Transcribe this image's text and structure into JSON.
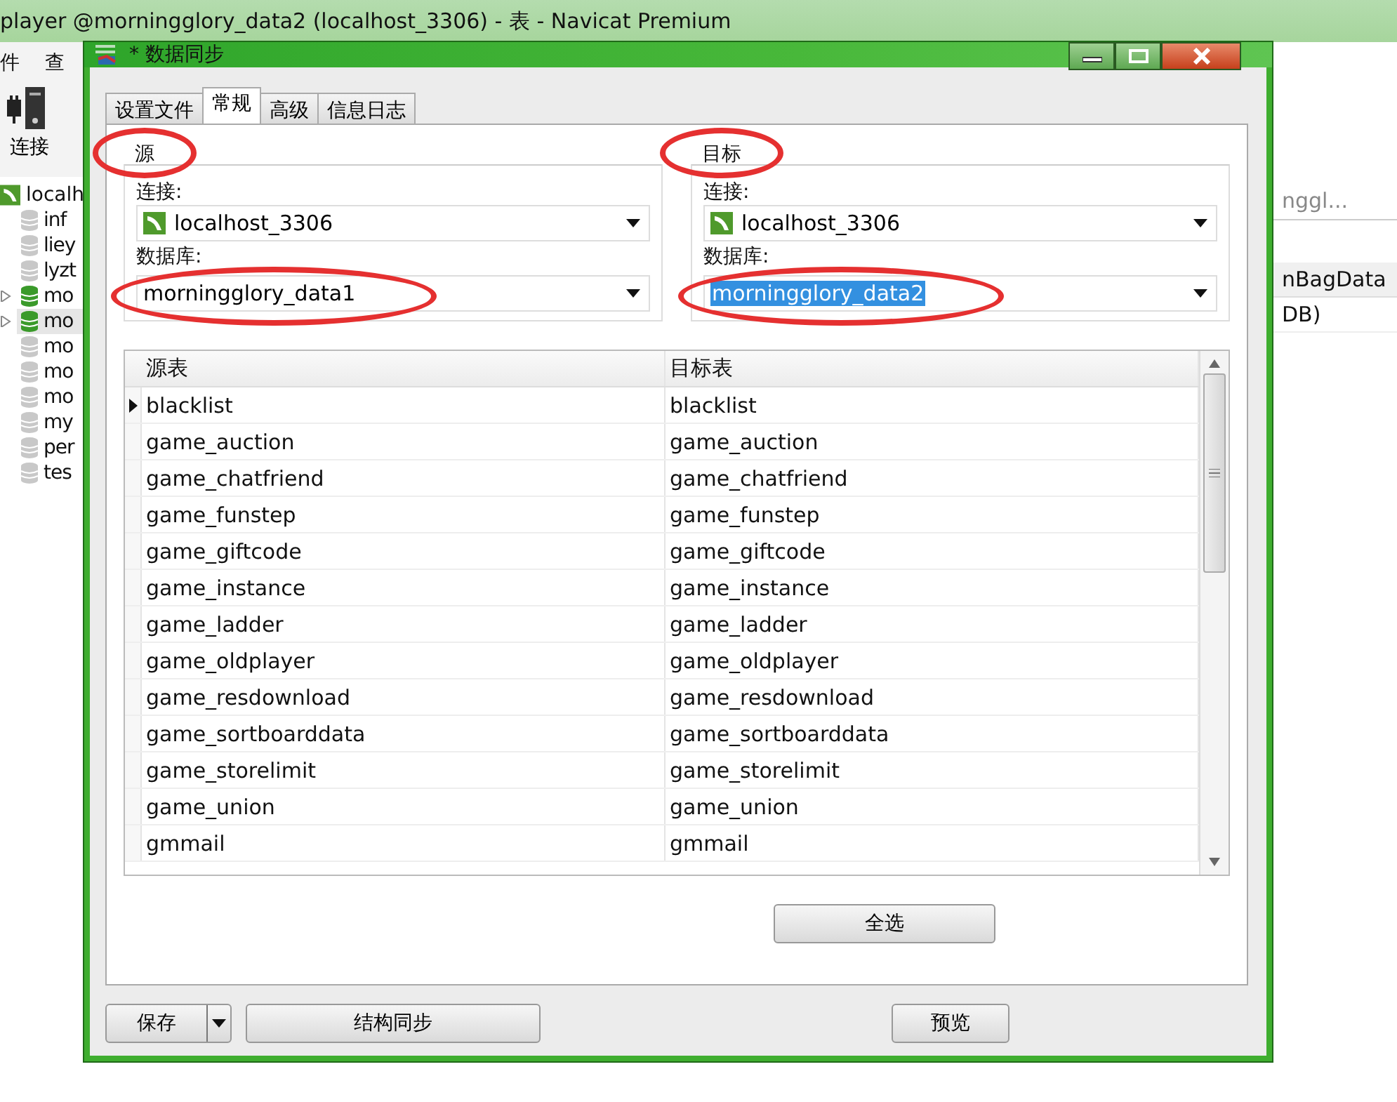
{
  "main_window": {
    "title": "player @morningglory_data2 (localhost_3306) - 表 - Navicat Premium",
    "menu": [
      "件",
      "查"
    ],
    "toolbar": [
      {
        "label": "连接"
      }
    ],
    "tree": [
      {
        "label": "localh",
        "children": [
          {
            "label": "inf",
            "open": false,
            "selected": false
          },
          {
            "label": "liey",
            "open": false,
            "selected": false
          },
          {
            "label": "lyzt",
            "open": false,
            "selected": false
          },
          {
            "label": "mo",
            "open": true,
            "selected": false
          },
          {
            "label": "mo",
            "open": true,
            "selected": true
          },
          {
            "label": "mo",
            "open": false,
            "selected": false
          },
          {
            "label": "mo",
            "open": false,
            "selected": false
          },
          {
            "label": "mo",
            "open": false,
            "selected": false
          },
          {
            "label": "my",
            "open": false,
            "selected": false
          },
          {
            "label": "per",
            "open": false,
            "selected": false
          },
          {
            "label": "tes",
            "open": false,
            "selected": false
          }
        ]
      }
    ],
    "right_panel": {
      "search_value": "nggl...",
      "column_header": "nBagData",
      "cell": "DB)"
    }
  },
  "dialog": {
    "title": "* 数据同步",
    "tabs": [
      {
        "label": "设置文件",
        "selected": false
      },
      {
        "label": "常规",
        "selected": true
      },
      {
        "label": "高级",
        "selected": false
      },
      {
        "label": "信息日志",
        "selected": false
      }
    ],
    "source": {
      "legend": "源",
      "legend_circled": true,
      "connection_label": "连接:",
      "connection": "localhost_3306",
      "database_label": "数据库:",
      "database": "morningglory_data1",
      "database_circled": true,
      "database_highlighted": false
    },
    "target": {
      "legend": "目标",
      "legend_circled": true,
      "connection_label": "连接:",
      "connection": "localhost_3306",
      "database_label": "数据库:",
      "database": "morningglory_data2",
      "database_circled": true,
      "database_highlighted": true
    },
    "table": {
      "columns": [
        "源表",
        "目标表"
      ],
      "rows": [
        {
          "source": "blacklist",
          "target": "blacklist",
          "current": true
        },
        {
          "source": "game_auction",
          "target": "game_auction",
          "current": false
        },
        {
          "source": "game_chatfriend",
          "target": "game_chatfriend",
          "current": false
        },
        {
          "source": "game_funstep",
          "target": "game_funstep",
          "current": false
        },
        {
          "source": "game_giftcode",
          "target": "game_giftcode",
          "current": false
        },
        {
          "source": "game_instance",
          "target": "game_instance",
          "current": false
        },
        {
          "source": "game_ladder",
          "target": "game_ladder",
          "current": false
        },
        {
          "source": "game_oldplayer",
          "target": "game_oldplayer",
          "current": false
        },
        {
          "source": "game_resdownload",
          "target": "game_resdownload",
          "current": false
        },
        {
          "source": "game_sortboarddata",
          "target": "game_sortboarddata",
          "current": false
        },
        {
          "source": "game_storelimit",
          "target": "game_storelimit",
          "current": false
        },
        {
          "source": "game_union",
          "target": "game_union",
          "current": false
        },
        {
          "source": "gmmail",
          "target": "gmmail",
          "current": false
        }
      ]
    },
    "select_all_button": "全选",
    "save_button": "保存",
    "structure_sync_button": "结构同步",
    "preview_button": "预览"
  }
}
